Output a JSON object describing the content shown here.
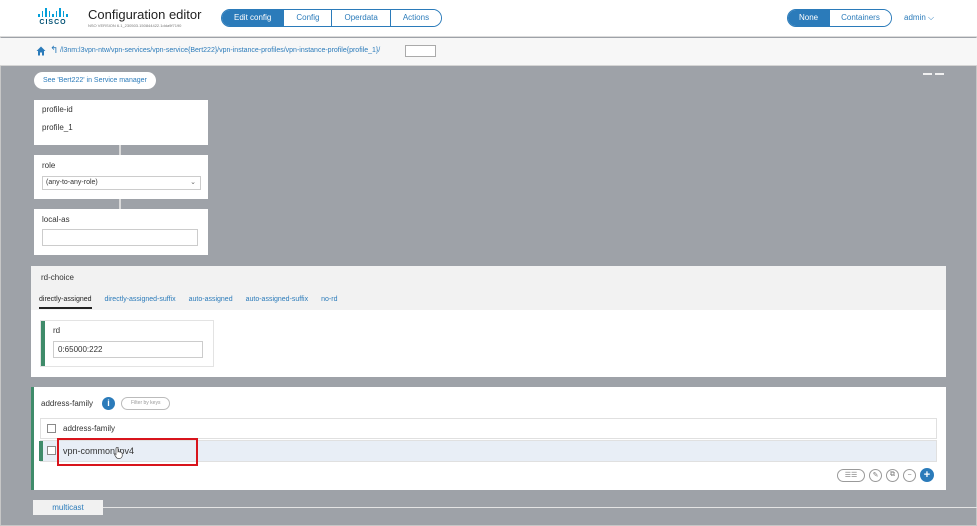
{
  "header": {
    "logo_text": "CISCO",
    "app_title": "Configuration editor",
    "app_version": "NSO VERSION 6.1_230503.150844422.1dda9f7190",
    "modes": [
      {
        "label": "Edit config",
        "active": true
      },
      {
        "label": "Config",
        "active": false
      },
      {
        "label": "Operdata",
        "active": false
      },
      {
        "label": "Actions",
        "active": false
      }
    ],
    "views": [
      {
        "label": "None",
        "active": true
      },
      {
        "label": "Containers",
        "active": false
      }
    ],
    "user": "admin ⌵"
  },
  "breadcrumb": {
    "path": "/l3nm:l3vpn-ntw/vpn-services/vpn-service{Bert222}/vpn-instance-profiles/vpn-instance-profile{profile_1}/",
    "input_value": ""
  },
  "service_manager_link": "See 'Bert222' in Service manager",
  "profile_id": {
    "label": "profile-id",
    "value": "profile_1"
  },
  "role": {
    "label": "role",
    "selected": "(any-to-any-role)"
  },
  "local_as": {
    "label": "local-as",
    "value": ""
  },
  "rd_choice": {
    "label": "rd-choice",
    "tabs": [
      {
        "label": "directly-assigned",
        "active": true
      },
      {
        "label": "directly-assigned-suffix",
        "active": false
      },
      {
        "label": "auto-assigned",
        "active": false
      },
      {
        "label": "auto-assigned-suffix",
        "active": false
      },
      {
        "label": "no-rd",
        "active": false
      }
    ],
    "rd_label": "rd",
    "rd_value": "0:65000:222"
  },
  "address_family": {
    "label": "address-family",
    "filter_placeholder": "Filter by keys",
    "column_header": "address-family",
    "rows": [
      "vpn-common:ipv4"
    ]
  },
  "multicast": {
    "label": "multicast"
  },
  "colors": {
    "accent": "#2b7bba",
    "highlight": "#d8141c",
    "green_marker": "#3f8b6a"
  }
}
